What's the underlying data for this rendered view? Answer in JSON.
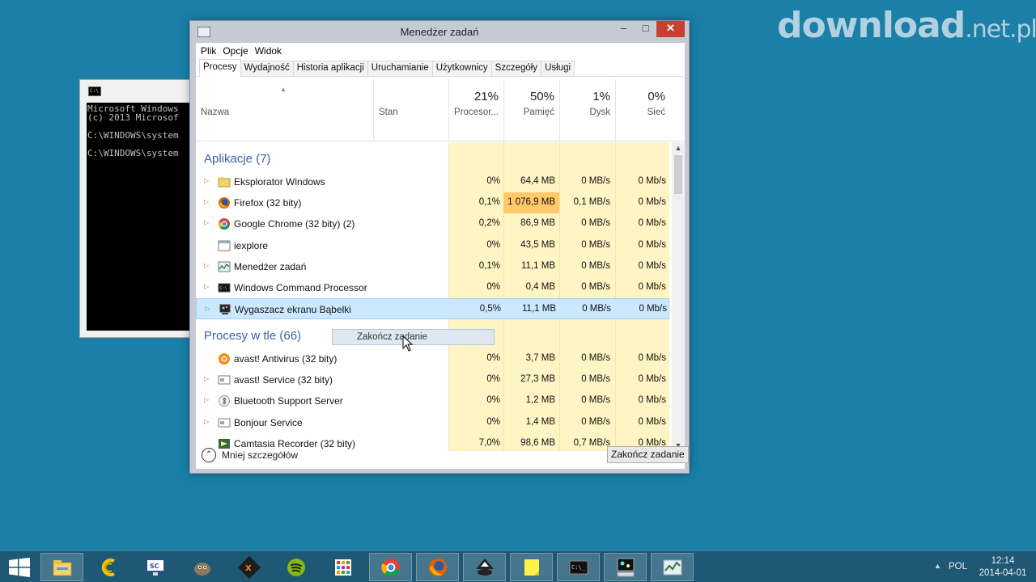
{
  "watermark": {
    "main": "download",
    "suffix": ".net.pl"
  },
  "console": {
    "lines": [
      "Microsoft Windows",
      "(c) 2013 Microsof",
      "",
      "C:\\WINDOWS\\system",
      "",
      "C:\\WINDOWS\\system"
    ]
  },
  "window": {
    "title": "Menedżer zadań",
    "menu": [
      "Plik",
      "Opcje",
      "Widok"
    ],
    "tabs": [
      "Procesy",
      "Wydajność",
      "Historia aplikacji",
      "Uruchamianie",
      "Użytkownicy",
      "Szczegóły",
      "Usługi"
    ],
    "active_tab": "Procesy"
  },
  "columns": {
    "name": "Nazwa",
    "status": "Stan",
    "cpu": {
      "pct": "21%",
      "label": "Procesor..."
    },
    "mem": {
      "pct": "50%",
      "label": "Pamięć"
    },
    "disk": {
      "pct": "1%",
      "label": "Dysk"
    },
    "net": {
      "pct": "0%",
      "label": "Sieć"
    }
  },
  "groups": {
    "apps": "Aplikacje (7)",
    "background": "Procesy w tle (66)"
  },
  "apps": [
    {
      "name": "Eksplorator Windows",
      "cpu": "0%",
      "mem": "64,4 MB",
      "disk": "0 MB/s",
      "net": "0 Mb/s",
      "icon": "folder-icon",
      "expandable": true
    },
    {
      "name": "Firefox (32 bity)",
      "cpu": "0,1%",
      "mem": "1 076,9 MB",
      "disk": "0,1 MB/s",
      "net": "0 Mb/s",
      "icon": "firefox-icon",
      "expandable": true
    },
    {
      "name": "Google Chrome (32 bity) (2)",
      "cpu": "0,2%",
      "mem": "86,9 MB",
      "disk": "0 MB/s",
      "net": "0 Mb/s",
      "icon": "chrome-icon",
      "expandable": true
    },
    {
      "name": "iexplore",
      "cpu": "0%",
      "mem": "43,5 MB",
      "disk": "0 MB/s",
      "net": "0 Mb/s",
      "icon": "app-window-icon",
      "expandable": false
    },
    {
      "name": "Menedżer zadań",
      "cpu": "0,1%",
      "mem": "11,1 MB",
      "disk": "0 MB/s",
      "net": "0 Mb/s",
      "icon": "task-manager-icon",
      "expandable": true
    },
    {
      "name": "Windows Command Processor",
      "cpu": "0%",
      "mem": "0,4 MB",
      "disk": "0 MB/s",
      "net": "0 Mb/s",
      "icon": "cmd-icon",
      "expandable": true
    },
    {
      "name": "Wygaszacz ekranu Bąbelki",
      "cpu": "0,5%",
      "mem": "11,1 MB",
      "disk": "0 MB/s",
      "net": "0 Mb/s",
      "icon": "screensaver-icon",
      "expandable": true,
      "selected": true
    }
  ],
  "background": [
    {
      "name": "avast! Antivirus (32 bity)",
      "cpu": "0%",
      "mem": "3,7 MB",
      "disk": "0 MB/s",
      "net": "0 Mb/s",
      "icon": "avast-icon",
      "expandable": false
    },
    {
      "name": "avast! Service (32 bity)",
      "cpu": "0%",
      "mem": "27,3 MB",
      "disk": "0 MB/s",
      "net": "0 Mb/s",
      "icon": "service-icon",
      "expandable": true
    },
    {
      "name": "Bluetooth Support Server",
      "cpu": "0%",
      "mem": "1,2 MB",
      "disk": "0 MB/s",
      "net": "0 Mb/s",
      "icon": "bluetooth-icon",
      "expandable": true
    },
    {
      "name": "Bonjour Service",
      "cpu": "0%",
      "mem": "1,4 MB",
      "disk": "0 MB/s",
      "net": "0 Mb/s",
      "icon": "service-icon",
      "expandable": true
    },
    {
      "name": "Camtasia Recorder (32 bity)",
      "cpu": "7,0%",
      "mem": "98,6 MB",
      "disk": "0,7 MB/s",
      "net": "0 Mb/s",
      "icon": "camtasia-icon",
      "expandable": false
    }
  ],
  "context_menu": {
    "item": "Zakończ zadanie"
  },
  "footer": {
    "less_details": "Mniej szczegółów",
    "end_task": "Zakończ zadanie"
  },
  "taskbar": {
    "items": [
      "file-explorer-icon",
      "ccleaner-icon",
      "screencast-icon",
      "gimp-icon",
      "xampp-icon",
      "spotify-icon",
      "apps-grid-icon",
      "chrome-icon",
      "firefox-icon",
      "inkscape-icon",
      "sticky-notes-icon",
      "cmd-icon",
      "screensaver-icon",
      "task-manager-icon"
    ],
    "active": [
      0,
      7,
      8,
      9,
      10,
      11,
      12,
      13
    ],
    "lang": "POL",
    "time": "12:14",
    "date": "2014-04-01"
  },
  "colors": {
    "heat": "#fff4c4",
    "heat_strong": "#ffc869",
    "selected": "#cce8ff",
    "group": "#3d5fa8",
    "desktop": "#1b7fa8"
  }
}
